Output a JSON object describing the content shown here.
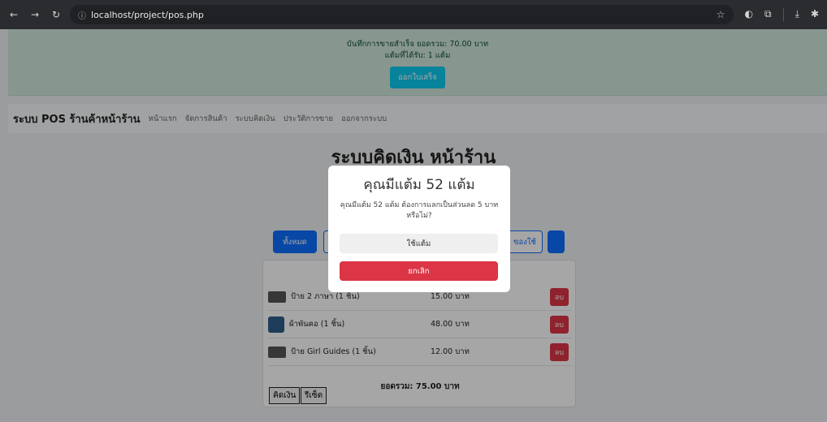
{
  "browser": {
    "url": "localhost/project/pos.php"
  },
  "alert": {
    "line1": "บันทึกการขายสำเร็จ ยอดรวม: 70.00 บาท",
    "line2": "แต้มที่ได้รับ: 1 แต้ม",
    "receipt_button": "ออกใบเสร็จ"
  },
  "navbar": {
    "brand": "ระบบ POS ร้านค้าหน้าร้าน",
    "links": [
      "หน้าแรก",
      "จัดการสินค้า",
      "ระบบคิดเงิน",
      "ประวัติการขาย",
      "ออกจากระบบ"
    ]
  },
  "main": {
    "title": "ระบบคิดเงิน หน้าร้าน",
    "categories": {
      "all": "ทั้งหมด",
      "supplies": "ของใช้"
    }
  },
  "cart": {
    "items": [
      {
        "name": "ป้าย 2 ภาษา (1 ชิ้น)",
        "price": "15.00 บาท"
      },
      {
        "name": "ผ้าพันคอ (1 ชิ้น)",
        "price": "48.00 บาท"
      },
      {
        "name": "ป้าย Girl Guides (1 ชิ้น)",
        "price": "12.00 บาท"
      }
    ],
    "delete_label": "ลบ",
    "total": "ยอดรวม: 75.00 บาท",
    "checkout_label": "คิดเงิน",
    "reset_label": "รีเซ็ต"
  },
  "modal": {
    "title": "คุณมีแต้ม 52 แต้ม",
    "message": "คุณมีแต้ม 52 แต้ม ต้องการแลกเป็นส่วนลด 5 บาท หรือไม่?",
    "confirm_label": "ใช้แต้ม",
    "cancel_label": "ยกเลิก"
  },
  "colors": {
    "primary": "#0d6efd",
    "danger": "#dc3545",
    "info": "#0dcaf0",
    "success_bg": "#d1e7dd"
  }
}
